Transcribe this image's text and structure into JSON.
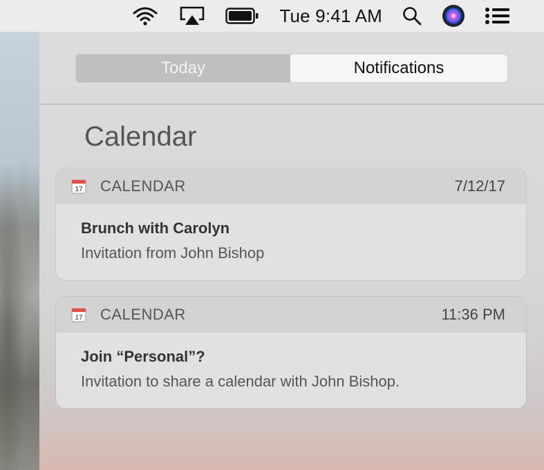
{
  "menubar": {
    "clock": "Tue 9:41 AM",
    "icons": [
      "wifi-icon",
      "airplay-icon",
      "battery-icon",
      "spotlight-search-icon",
      "siri-icon",
      "notification-center-icon"
    ]
  },
  "panel": {
    "tabs": [
      {
        "label": "Today",
        "selected": false
      },
      {
        "label": "Notifications",
        "selected": true
      }
    ],
    "section_title": "Calendar",
    "notifications": [
      {
        "app": "CALENDAR",
        "time": "7/12/17",
        "title": "Brunch with Carolyn",
        "subtitle": "Invitation from John Bishop",
        "icon": "calendar-icon"
      },
      {
        "app": "CALENDAR",
        "time": "11:36 PM",
        "title": "Join “Personal”?",
        "subtitle": "Invitation to share a calendar with John Bishop.",
        "icon": "calendar-icon"
      }
    ]
  },
  "colors": {
    "menubar": "#ececec",
    "selected_tab": "#f6f6f6",
    "unselected_tab": "#bfbfbf"
  }
}
